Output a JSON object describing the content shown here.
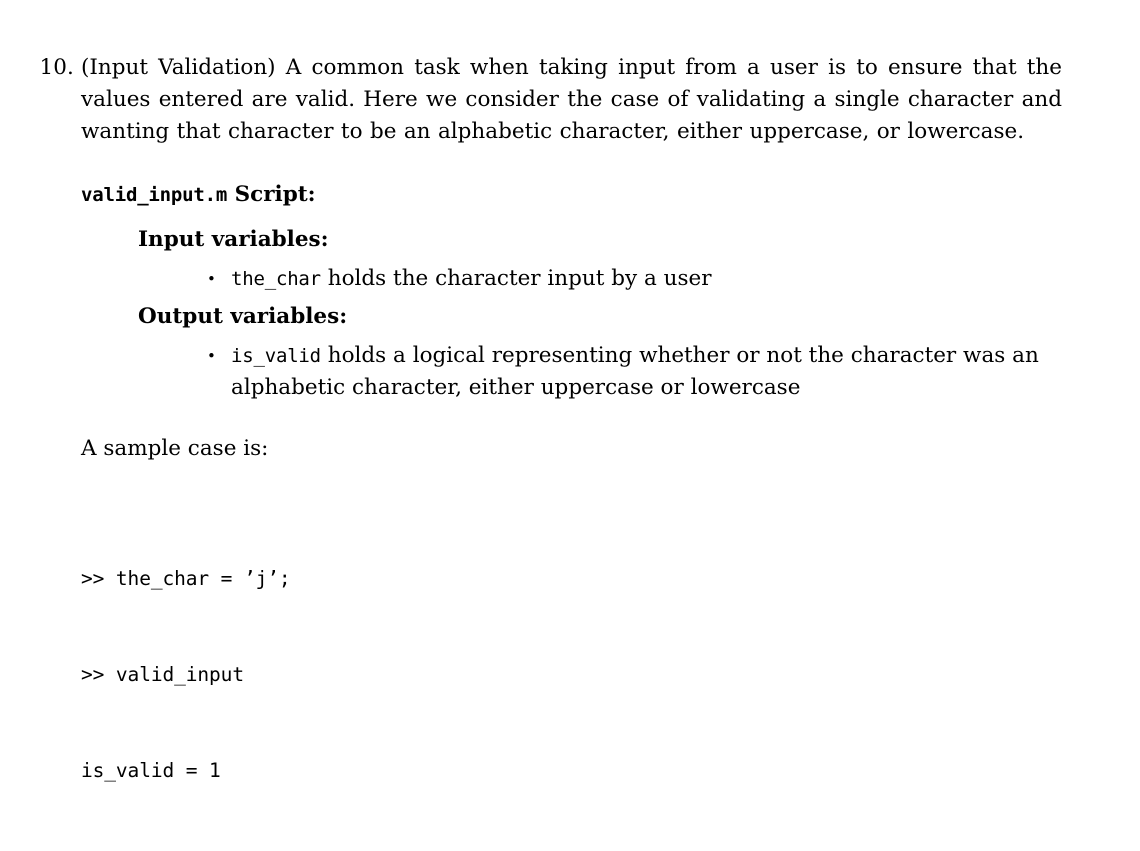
{
  "document": {
    "type": "homework-problem",
    "background_color": "#ffffff",
    "text_color": "#000000"
  },
  "problem": {
    "number": "10.",
    "intro_title": "(Input Validation)",
    "intro_paragraph": "(Input Validation) A common task when taking input from a user is to ensure that the values entered are valid. Here we consider the case of validating a single character and wanting that character to be an alphabetic character, either uppercase, or lowercase.",
    "script": {
      "file_name": "valid_input.m",
      "label": "Script:"
    },
    "input_variables": {
      "heading": "Input variables:",
      "items": [
        {
          "bullet": "•",
          "code": "the_char",
          "description": " holds the character input by a user"
        }
      ]
    },
    "output_variables": {
      "heading": "Output variables:",
      "items": [
        {
          "bullet": "•",
          "code": "is_valid",
          "description": " holds a logical representing whether or not the character was an alphabetic character, either uppercase or lowercase"
        }
      ]
    },
    "sample_case": {
      "intro": "A sample case is:",
      "lines": [
        ">> the_char = ’j’;",
        ">> valid_input",
        "is_valid = 1"
      ]
    }
  }
}
